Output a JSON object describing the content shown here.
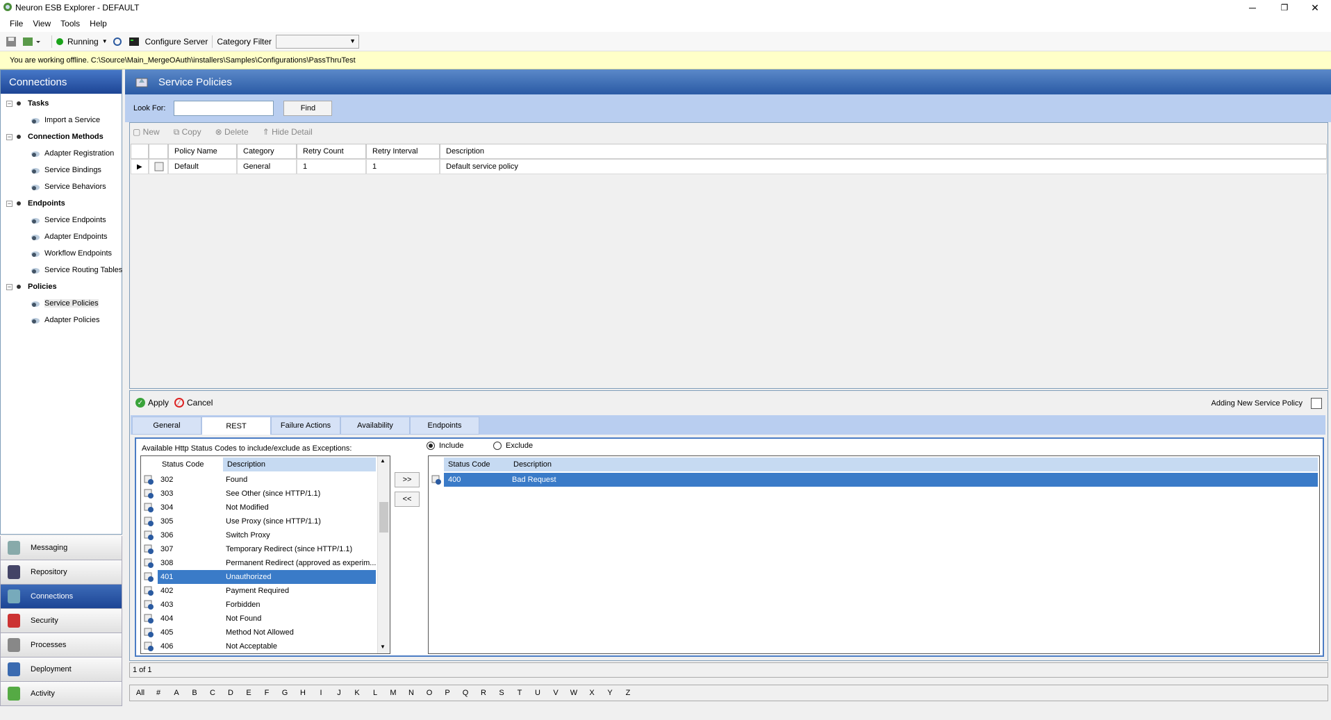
{
  "window": {
    "title": "Neuron ESB Explorer - DEFAULT",
    "minimize": "─",
    "restore": "❐",
    "close": "✕"
  },
  "menu": [
    "File",
    "View",
    "Tools",
    "Help"
  ],
  "toolbar": {
    "status": "Running",
    "configure_server": "Configure Server",
    "category_filter": "Category Filter",
    "category_value": ""
  },
  "offline_message": "You are working offline. C:\\Source\\Main_MergeOAuth\\installers\\Samples\\Configurations\\PassThruTest",
  "left": {
    "header": "Connections",
    "groups": [
      {
        "label": "Tasks",
        "items": [
          "Import a Service"
        ]
      },
      {
        "label": "Connection Methods",
        "items": [
          "Adapter Registration",
          "Service Bindings",
          "Service Behaviors"
        ]
      },
      {
        "label": "Endpoints",
        "items": [
          "Service Endpoints",
          "Adapter Endpoints",
          "Workflow Endpoints",
          "Service Routing Tables"
        ]
      },
      {
        "label": "Policies",
        "items": [
          "Service Policies",
          "Adapter Policies"
        ]
      }
    ],
    "selected_item": "Service Policies",
    "nav": [
      "Messaging",
      "Repository",
      "Connections",
      "Security",
      "Processes",
      "Deployment",
      "Activity"
    ],
    "active_nav": "Connections"
  },
  "main": {
    "title": "Service Policies",
    "look_for_label": "Look For:",
    "look_for_value": "",
    "find": "Find",
    "grid_toolbar": [
      "New",
      "Copy",
      "Delete",
      "Hide Detail"
    ],
    "columns": [
      "Policy Name",
      "Category",
      "Retry Count",
      "Retry Interval",
      "Description"
    ],
    "rows": [
      [
        "Default",
        "General",
        "1",
        "1",
        "Default service policy"
      ]
    ]
  },
  "detail": {
    "apply": "Apply",
    "cancel": "Cancel",
    "mode": "Adding New Service Policy",
    "tabs": [
      "General",
      "REST",
      "Failure Actions",
      "Availability",
      "Endpoints"
    ],
    "selected_tab": "REST",
    "available_label": "Available Http Status Codes to include/exclude as Exceptions:",
    "list_columns": [
      "Status Code",
      "Description"
    ],
    "available": [
      [
        "302",
        "Found"
      ],
      [
        "303",
        "See Other (since HTTP/1.1)"
      ],
      [
        "304",
        "Not Modified"
      ],
      [
        "305",
        "Use Proxy (since HTTP/1.1)"
      ],
      [
        "306",
        "Switch Proxy"
      ],
      [
        "307",
        "Temporary Redirect (since HTTP/1.1)"
      ],
      [
        "308",
        "Permanent Redirect (approved as experim..."
      ],
      [
        "401",
        "Unauthorized"
      ],
      [
        "402",
        "Payment Required"
      ],
      [
        "403",
        "Forbidden"
      ],
      [
        "404",
        "Not Found"
      ],
      [
        "405",
        "Method Not Allowed"
      ],
      [
        "406",
        "Not Acceptable"
      ]
    ],
    "available_selected": "401",
    "add_btn": ">>",
    "remove_btn": "<<",
    "include": "Include",
    "exclude": "Exclude",
    "mode_selected": "Include",
    "chosen": [
      [
        "400",
        "Bad Request"
      ]
    ]
  },
  "status": {
    "page": "1 of 1"
  },
  "alphabet": [
    "All",
    "#",
    "A",
    "B",
    "C",
    "D",
    "E",
    "F",
    "G",
    "H",
    "I",
    "J",
    "K",
    "L",
    "M",
    "N",
    "O",
    "P",
    "Q",
    "R",
    "S",
    "T",
    "U",
    "V",
    "W",
    "X",
    "Y",
    "Z"
  ]
}
